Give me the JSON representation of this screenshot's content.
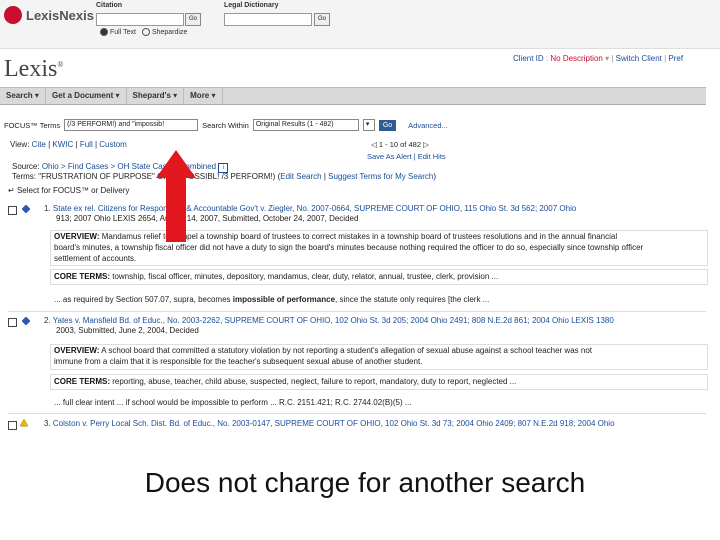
{
  "top": {
    "logo": "LexisNexis",
    "citation_label": "Citation",
    "dictionary_label": "Legal Dictionary",
    "go1": "Go",
    "go2": "Go",
    "radio_full_text": "Full Text",
    "radio_shepardize": "Shepardize"
  },
  "header": {
    "logo": "Lexis",
    "trademark": "®",
    "client_id": "Client ID",
    "no_description": "No Description",
    "switch_client": "Switch Client",
    "pref": "Pref"
  },
  "nav": {
    "search": "Search",
    "get_document": "Get a Document",
    "shepards": "Shepard's",
    "more": "More"
  },
  "focus": {
    "label": "FOCUS™ Terms",
    "query": "(/3 PERFORM!) and \"impossib!",
    "search_within_label": "Search Within",
    "search_within_value": "Original Results (1 - 482)",
    "go_label": "Go",
    "advanced_label": "Advanced..."
  },
  "view": {
    "label": "View:",
    "cite": "Cite",
    "kwic": "KWIC",
    "full": "Full",
    "custom": "Custom"
  },
  "pager": {
    "text": "1 - 10 of 482",
    "save_alert": "Save As Alert",
    "edit_hits": "Edit Hits"
  },
  "source": {
    "label": "Source:",
    "path": "Ohio > Find Cases > OH State Cases, Combined",
    "terms_label": "Terms:",
    "terms_value": "\"FRUSTRATION OF PURPOSE\" OR (IMPOSSIBL! /3 PERFORM!)",
    "edit_search": "Edit Search",
    "suggest_terms": "Suggest Terms for My Search"
  },
  "select_focus": "Select for FOCUS™ or Delivery",
  "results": [
    {
      "num": "1.",
      "title": "State ex rel. Citizens for Responsible & Accountable Gov't v. Ziegler, No. 2007-0664, SUPREME COURT OF OHIO, 115 Ohio St. 3d 562; 2007 Ohio",
      "cont": "913; 2007 Ohio LEXIS 2654, August 14, 2007, Submitted, October 24, 2007, Decided",
      "overview_label": "OVERVIEW:",
      "overview": [
        "Mandamus relief to compel a township board of trustees to correct mistakes in a township board of trustees resolutions and in the annual financial",
        "board's minutes, a township fiscal officer did not have a duty to sign the board's minutes because nothing required the officer to do so, especially since township officer",
        "settlement of accounts."
      ],
      "core_label": "CORE TERMS:",
      "core": "township, fiscal officer, minutes, depository, mandamus, clear, duty, relator, annual, trustee, clerk, provision ...",
      "snippet_pre": "... as required by Section 507.07, supra, becomes ",
      "snippet_bold": "impossible of performance",
      "snippet_post": ", since the statute only requires [the clerk ..."
    },
    {
      "num": "2.",
      "title": "Yates v. Mansfield Bd. of Educ., No. 2003-2262, SUPREME COURT OF OHIO, 102 Ohio St. 3d 205; 2004 Ohio 2491; 808 N.E.2d 861; 2004 Ohio LEXIS 1380",
      "cont": "2003, Submitted, June 2, 2004, Decided",
      "overview_label": "OVERVIEW:",
      "overview": [
        "A school board that committed a statutory violation by not reporting a student's allegation of sexual abuse against a school teacher was not",
        "immune from a claim that it is responsible for the teacher's subsequent sexual abuse of another student."
      ],
      "core_label": "CORE TERMS:",
      "core": "reporting, abuse, teacher, child abuse, suspected, neglect, failure to report, mandatory, duty to report, neglected ...",
      "snippet_pre": "... full clear intent ... if school would be impossible to perform ... R.C. 2151.421; R.C. 2744.02(B)(5) ...",
      "snippet_bold": "",
      "snippet_post": ""
    },
    {
      "num": "3.",
      "title": "Colston v. Perry Local Sch. Dist. Bd. of Educ., No. 2003-0147, SUPREME COURT OF OHIO, 102 Ohio St. 3d 73; 2004 Ohio 2409; 807 N.E.2d 918; 2004 Ohio"
    }
  ],
  "caption": "Does not charge for another search",
  "colors": {
    "red_arrow": "#e3171e",
    "link": "#1a4d99",
    "nav_bg": "#d9d9d9",
    "go_blue": "#2f5c96"
  }
}
